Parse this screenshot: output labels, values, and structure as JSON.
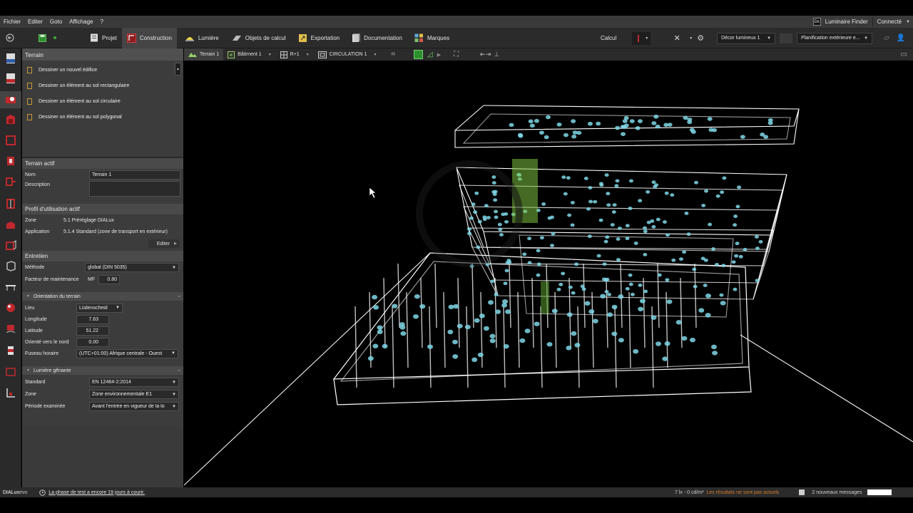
{
  "menu": {
    "items": [
      "Fichier",
      "Editer",
      "Goto",
      "Affichage",
      "?"
    ],
    "luminaire_finder": "Luminaire Finder",
    "connecte": "Connecté"
  },
  "toolbar": {
    "tabs": [
      {
        "label": "Projet",
        "icon": "project-icon"
      },
      {
        "label": "Construction",
        "icon": "construction-icon"
      },
      {
        "label": "Lumière",
        "icon": "light-icon"
      },
      {
        "label": "Objets de calcul",
        "icon": "calc-objects-icon"
      },
      {
        "label": "Exportation",
        "icon": "export-icon"
      },
      {
        "label": "Documentation",
        "icon": "documentation-icon"
      },
      {
        "label": "Marques",
        "icon": "brands-icon"
      }
    ],
    "calcul": "Calcul",
    "decor_select": "Décor lumineux 1",
    "planif_select": "Planification extérieure e..."
  },
  "viewbar": {
    "tabs": [
      {
        "label": "Terrain 1"
      },
      {
        "label": "Bâtiment 1"
      },
      {
        "label": "R+1"
      },
      {
        "label": "CIRCULATION 1"
      }
    ]
  },
  "panel": {
    "terrain_title": "Terrain",
    "tasks": [
      "Dessiner un nouvel édifice",
      "Dessiner un élément au sol rectangulaire",
      "Dessiner un élément au sol circulaire",
      "Dessiner un élément au sol polygonal"
    ],
    "terrain_actif": {
      "header": "Terrain actif",
      "nom_label": "Nom",
      "nom_value": "Terrain 1",
      "description_label": "Description",
      "description_value": ""
    },
    "profil": {
      "header": "Profil d'utilisation actif",
      "zone_label": "Zone",
      "zone_value": "5.1 Préréglage DIALux",
      "application_label": "Application",
      "application_value": "5.1.4 Standard (zone de transport en extérieur)",
      "edit_button": "Editer"
    },
    "entretien": {
      "header": "Entretien",
      "methode_label": "Méthode",
      "methode_value": "global (DIN 5035)",
      "facteur_label": "Facteur de maintenance",
      "mf_label": "MF",
      "mf_value": "0.80"
    },
    "orientation": {
      "header": "Orientation du terrain",
      "lieu_label": "Lieu",
      "lieu_value": "Lüdenscheid",
      "longitude_label": "Longitude",
      "longitude_value": "7.63",
      "latitude_label": "Latitude",
      "latitude_value": "51.22",
      "nord_label": "Orienté vers le nord",
      "nord_value": "0.00",
      "fuseau_label": "Fuseau horaire",
      "fuseau_value": "(UTC+01:00) Afrique centrale - Ouest"
    },
    "lumiere_genante": {
      "header": "Lumière gênante",
      "standard_label": "Standard",
      "standard_value": "EN 12464-2:2014",
      "zone_label": "Zone",
      "zone_value": "Zone environnementale E1",
      "periode_label": "Période examinée",
      "periode_value": "Avant l'entrée en vigueur de la lo"
    }
  },
  "status": {
    "logo_main": "DIALux",
    "logo_sub": "evo",
    "trial": "La phase de test a encore 19 jours à courir.",
    "lux": "7 lx - 0 cd/m²",
    "warning": "Les résultats ne sont pas actuels",
    "messages": "2 nouveaux messages"
  },
  "colors": {
    "accent_red": "#c0282d",
    "warning": "#d47b2a",
    "luminaire": "#7fd7e6",
    "wireframe": "#ffffff"
  }
}
